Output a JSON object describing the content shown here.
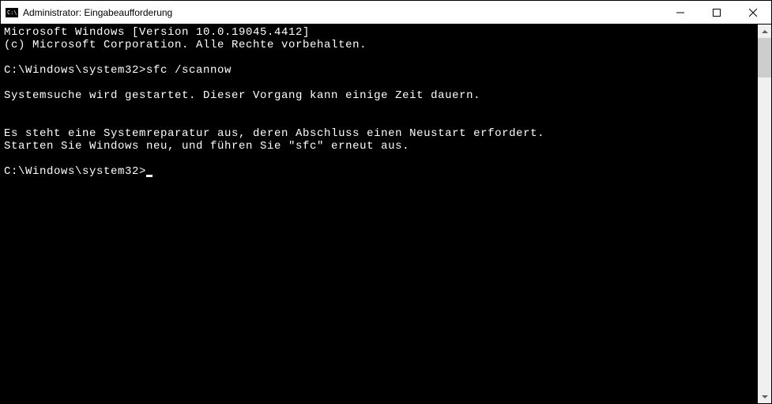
{
  "window": {
    "title": "Administrator: Eingabeaufforderung"
  },
  "terminal": {
    "lines": {
      "version": "Microsoft Windows [Version 10.0.19045.4412]",
      "copyright": "(c) Microsoft Corporation. Alle Rechte vorbehalten.",
      "blank1": "",
      "prompt1_prefix": "C:\\Windows\\system32>",
      "prompt1_cmd": "sfc /scannow",
      "blank2": "",
      "scan_start": "Systemsuche wird gestartet. Dieser Vorgang kann einige Zeit dauern.",
      "blank3": "",
      "blank4": "",
      "repair_pending": "Es steht eine Systemreparatur aus, deren Abschluss einen Neustart erfordert.",
      "restart_instr": "Starten Sie Windows neu, und führen Sie \"sfc\" erneut aus.",
      "blank5": "",
      "prompt2": "C:\\Windows\\system32>"
    }
  }
}
